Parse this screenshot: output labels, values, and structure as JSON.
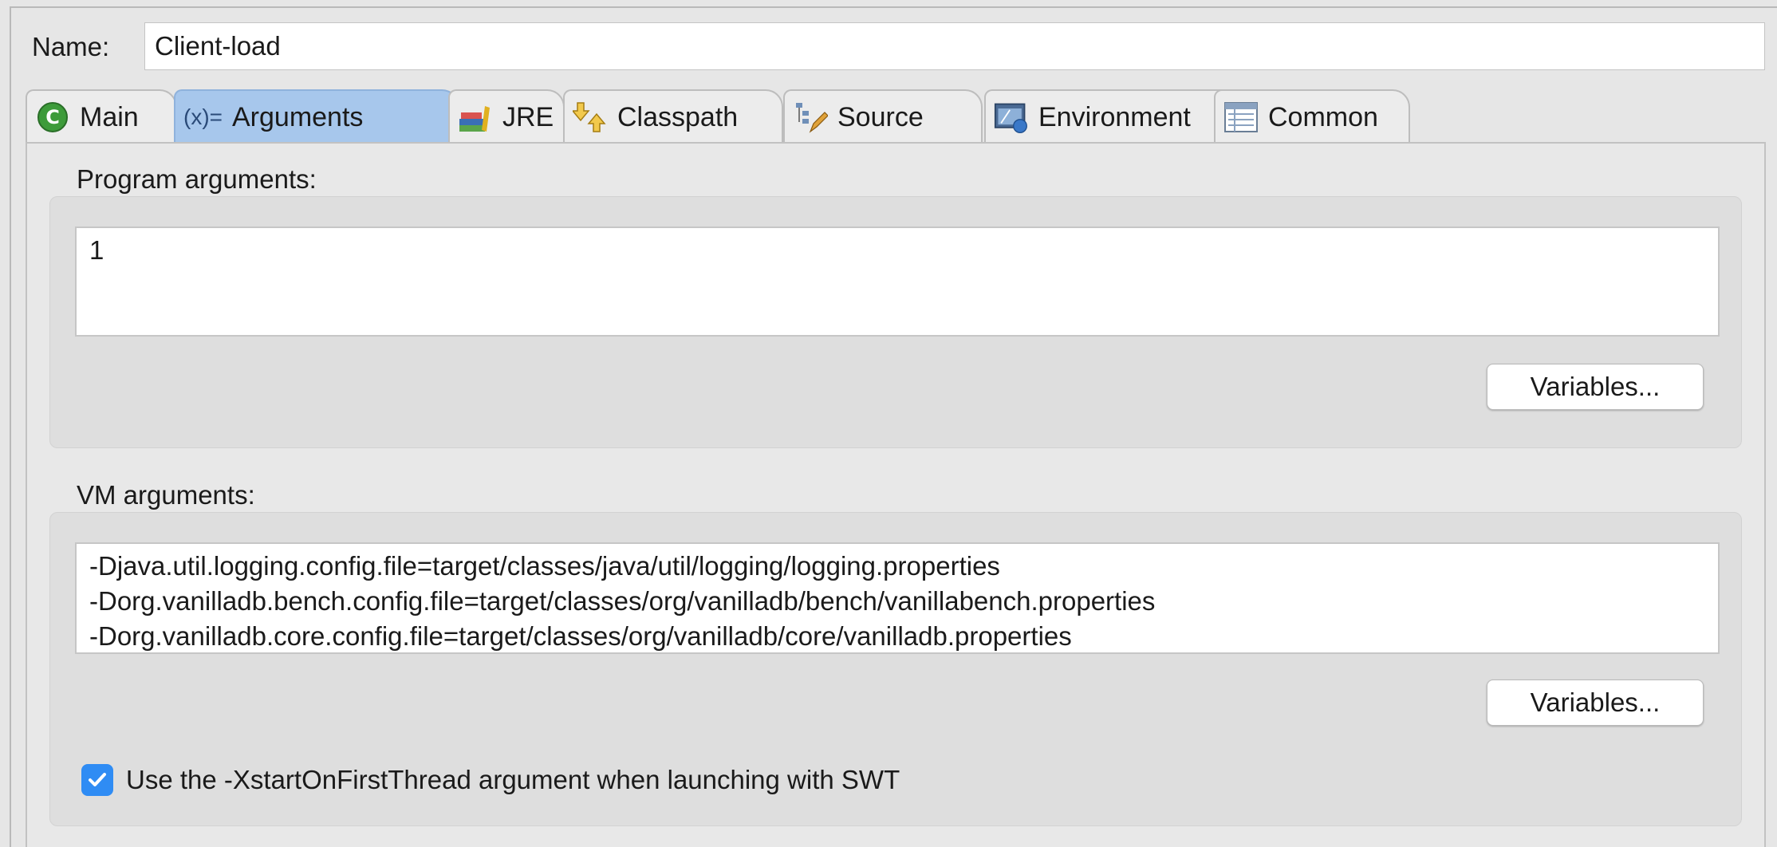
{
  "form": {
    "name_label": "Name:",
    "name_value": "Client-load"
  },
  "tabs": [
    {
      "label": "Main",
      "icon": "java-main-icon",
      "active": false
    },
    {
      "label": "Arguments",
      "icon": "arguments-icon",
      "prefix": "(x)=",
      "active": true
    },
    {
      "label": "JRE",
      "icon": "jre-icon",
      "active": false
    },
    {
      "label": "Classpath",
      "icon": "classpath-icon",
      "active": false
    },
    {
      "label": "Source",
      "icon": "source-icon",
      "active": false
    },
    {
      "label": "Environment",
      "icon": "environment-icon",
      "active": false
    },
    {
      "label": "Common",
      "icon": "common-icon",
      "active": false
    }
  ],
  "program_args": {
    "label": "Program arguments:",
    "value": "1",
    "variables_button": "Variables..."
  },
  "vm_args": {
    "label": "VM arguments:",
    "value": "-Djava.util.logging.config.file=target/classes/java/util/logging/logging.properties\n-Dorg.vanilladb.bench.config.file=target/classes/org/vanilladb/bench/vanillabench.properties\n-Dorg.vanilladb.core.config.file=target/classes/org/vanilladb/core/vanilladb.properties",
    "variables_button": "Variables..."
  },
  "swt_option": {
    "label": "Use the -XstartOnFirstThread argument when launching with SWT",
    "checked": true
  },
  "colors": {
    "active_tab": "#a7c7ec",
    "checkbox": "#2f8cf4",
    "background": "#e6e6e6"
  }
}
